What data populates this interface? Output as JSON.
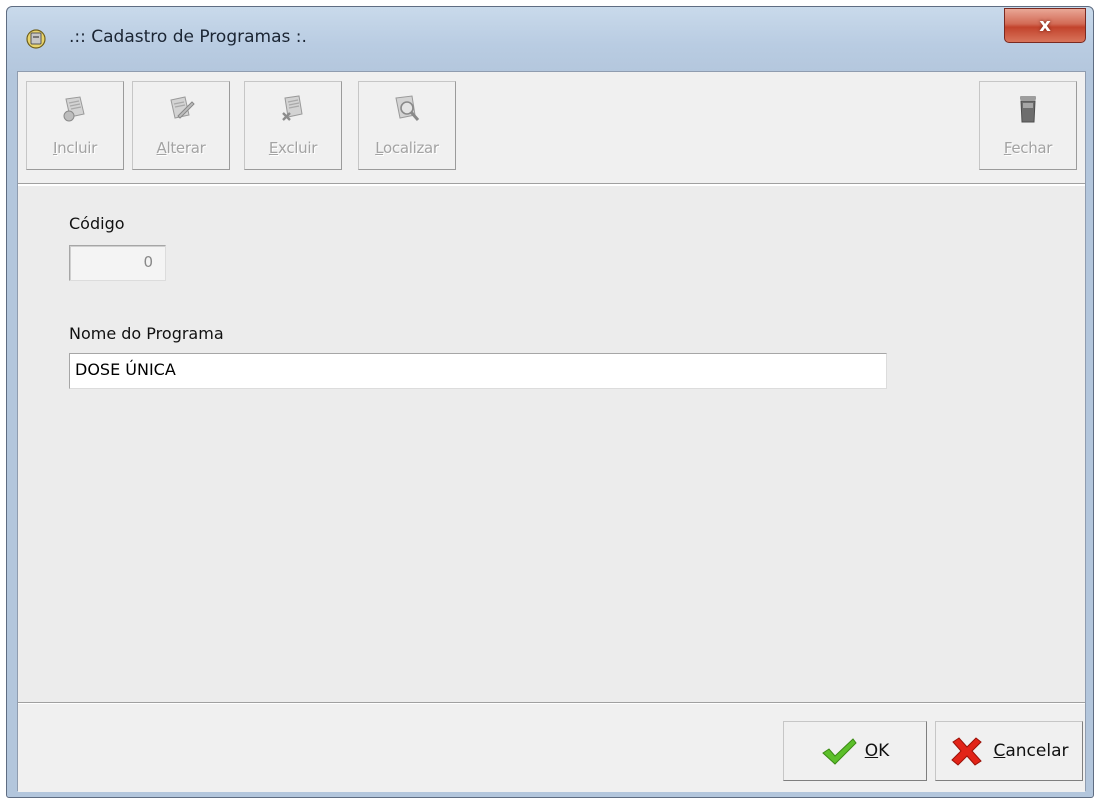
{
  "window": {
    "title": ".:: Cadastro de Programas :.",
    "close_symbol": "x"
  },
  "toolbar": {
    "buttons": [
      {
        "label": "Incluir",
        "icon": "add-document-icon",
        "enabled": false
      },
      {
        "label": "Alterar",
        "icon": "edit-document-icon",
        "enabled": false
      },
      {
        "label": "Excluir",
        "icon": "delete-document-icon",
        "enabled": false
      },
      {
        "label": "Localizar",
        "icon": "search-document-icon",
        "enabled": false
      },
      {
        "label": "Fechar",
        "icon": "trash-bin-icon",
        "enabled": false
      }
    ]
  },
  "form": {
    "codigo_label": "Código",
    "codigo_value": "0",
    "nome_label": "Nome do Programa",
    "nome_value": "DOSE ÚNICA"
  },
  "footer": {
    "ok_label": "OK",
    "cancel_label": "Cancelar"
  },
  "colors": {
    "accent_ok": "#5cbf2a",
    "accent_cancel": "#e22418",
    "disabled_text": "#a3a3a3"
  }
}
